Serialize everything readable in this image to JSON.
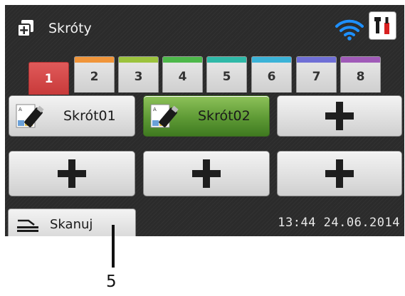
{
  "header": {
    "title": "Skróty",
    "app_icon": "shortcuts-icon",
    "wifi_icon": "wifi-icon",
    "tools_icon": "tools-icon"
  },
  "tabs": [
    {
      "label": "1",
      "color": "#e05050",
      "active": true
    },
    {
      "label": "2",
      "color": "#f0953a"
    },
    {
      "label": "3",
      "color": "#9cc33d"
    },
    {
      "label": "4",
      "color": "#4db84a"
    },
    {
      "label": "5",
      "color": "#2fb9a8"
    },
    {
      "label": "6",
      "color": "#3bb3d8"
    },
    {
      "label": "7",
      "color": "#6f6fd6"
    },
    {
      "label": "8",
      "color": "#a05ab8"
    }
  ],
  "shortcuts": [
    {
      "label": "Skrót01",
      "icon": "usb-drive-icon",
      "highlighted": false
    },
    {
      "label": "Skrót02",
      "icon": "usb-drive-icon",
      "highlighted": true
    },
    {
      "label": "",
      "icon": "plus-icon"
    },
    {
      "label": "",
      "icon": "plus-icon"
    },
    {
      "label": "",
      "icon": "plus-icon"
    },
    {
      "label": "",
      "icon": "plus-icon"
    }
  ],
  "bottom": {
    "scan_label": "Skanuj",
    "datetime": "13:44 24.06.2014"
  },
  "callout": {
    "number": "5"
  },
  "colors": {
    "screen_bg": "#2b2b2b",
    "highlight": "#5e9a35",
    "wifi": "#1e90ff"
  }
}
